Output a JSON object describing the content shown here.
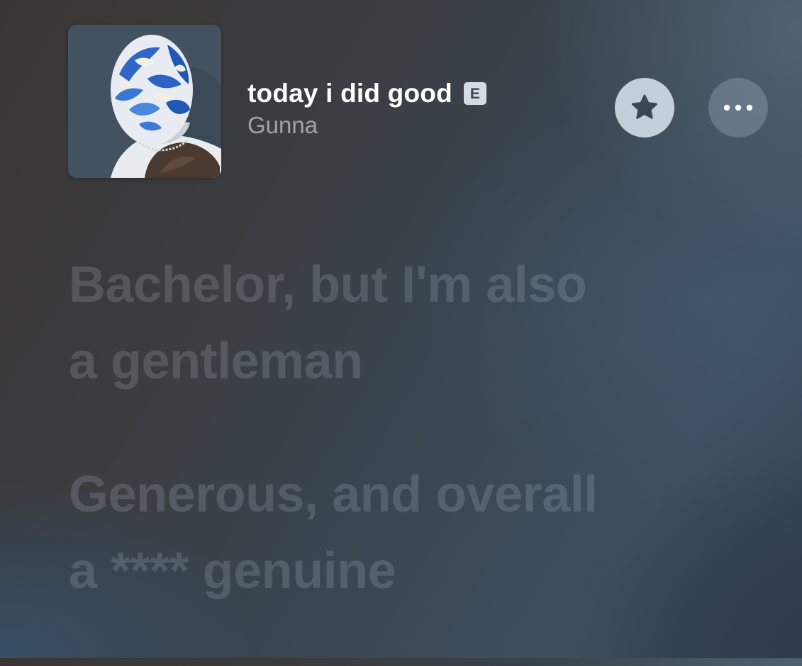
{
  "now_playing": {
    "title": "today i did good",
    "explicit_badge": "E",
    "artist": "Gunna"
  },
  "buttons": {
    "favorite_icon": "star-icon",
    "more_icon": "ellipsis-icon"
  },
  "lyrics": {
    "lines": [
      "Bachelor, but I'm also\na gentleman",
      "Generous, and overall\na **** genuine"
    ]
  },
  "colors": {
    "title_text": "#ffffff",
    "artist_text": "#b7c1cb",
    "badge_bg": "#d5dbe2",
    "favorite_button_bg": "#d6e0ea",
    "icon_dark": "#3c4753"
  }
}
